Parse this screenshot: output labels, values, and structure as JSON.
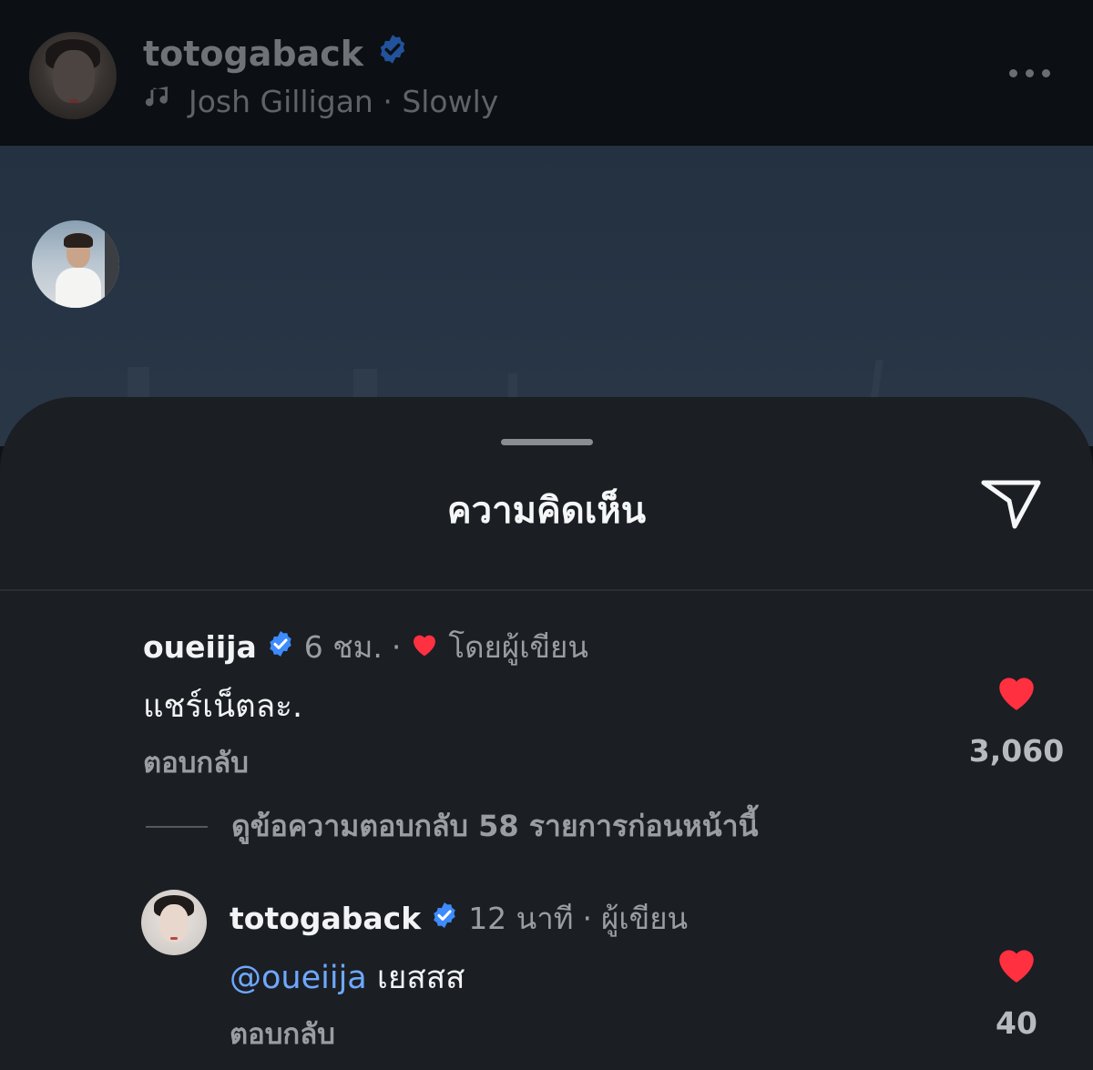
{
  "post": {
    "username": "totogaback",
    "music": "Josh Gilligan · Slowly"
  },
  "comments_sheet": {
    "title": "ความคิดเห็น",
    "view_replies": "ดูข้อความตอบกลับ 58 รายการก่อนหน้านี้",
    "comments": [
      {
        "username": "oueiija",
        "time": "6 ชม.",
        "separator": "·",
        "liked_by_author": "โดยผู้เขียน",
        "text": "แชร์เน็ตละ.",
        "reply_label": "ตอบกลับ",
        "likes": "3,060"
      },
      {
        "username": "totogaback",
        "time": "12 นาที",
        "separator": "·",
        "author_badge": "ผู้เขียน",
        "mention": "@oueiija",
        "text": "เยสสส",
        "reply_label": "ตอบกลับ",
        "likes": "40"
      }
    ]
  },
  "colors": {
    "verified": "#3d8bfd",
    "heart": "#ff3040",
    "mention": "#6ea8fe"
  }
}
